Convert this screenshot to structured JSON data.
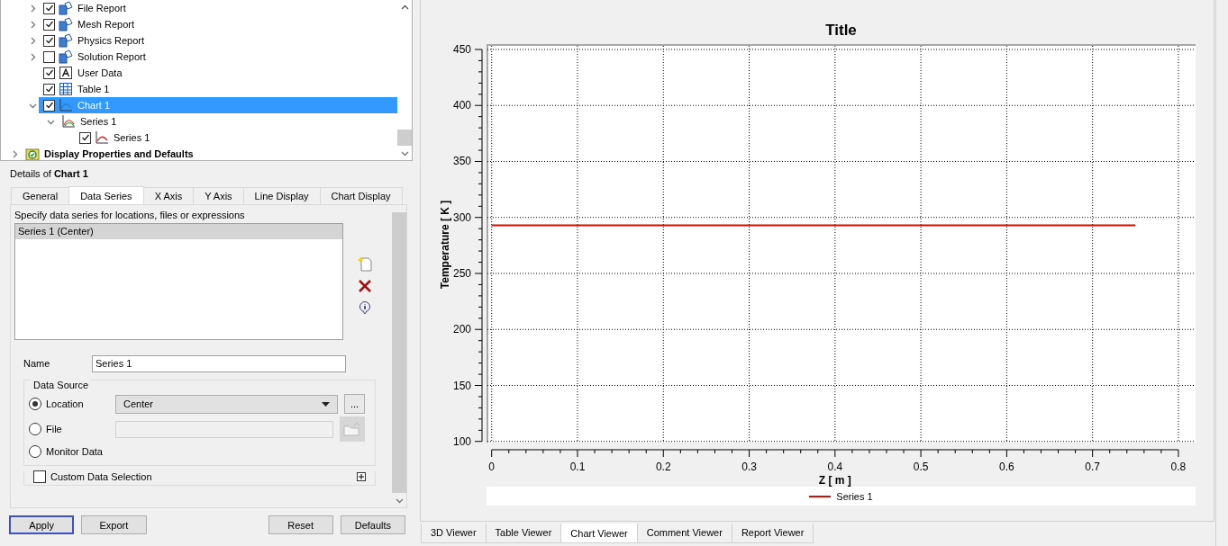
{
  "tree": [
    {
      "children": [
        {
          "label": "File Report",
          "kind": "report",
          "checked": true,
          "expanded": false,
          "selected": false
        },
        {
          "label": "Mesh Report",
          "kind": "report",
          "checked": true,
          "expanded": false,
          "selected": false
        },
        {
          "label": "Physics Report",
          "kind": "report",
          "checked": true,
          "expanded": false,
          "selected": false
        },
        {
          "label": "Solution Report",
          "kind": "report",
          "checked": false,
          "expanded": false,
          "selected": false
        },
        {
          "label": "User Data",
          "kind": "text",
          "checked": true,
          "selected": false
        },
        {
          "label": "Table 1",
          "kind": "table",
          "checked": true,
          "selected": false
        },
        {
          "label": "Chart 1",
          "kind": "chart",
          "checked": true,
          "expanded": true,
          "selected": true,
          "children": [
            {
              "label": "Series 1",
              "kind": "series",
              "expanded": true,
              "selected": false,
              "children": [
                {
                  "label": "Series 1",
                  "kind": "series-line",
                  "checked": true,
                  "selected": false
                }
              ]
            }
          ]
        }
      ]
    },
    {
      "label": "Display Properties and Defaults",
      "kind": "folder",
      "expanded": false,
      "selected": false
    }
  ],
  "details_title": "Details of **Chart 1**",
  "detail_tabs": [
    {
      "label": "General",
      "selected": false
    },
    {
      "label": "Data Series",
      "selected": true
    },
    {
      "label": "X Axis",
      "selected": false
    },
    {
      "label": "Y Axis",
      "selected": false
    },
    {
      "label": "Line Display",
      "selected": false
    },
    {
      "label": "Chart Display",
      "selected": false
    }
  ],
  "series_hint": "Specify data series for locations, files or expressions",
  "series_list": [
    {
      "label": "Series 1 (Center)",
      "selected": true
    }
  ],
  "name": {
    "label": "Name",
    "value": "Series 1"
  },
  "data_source": {
    "title": "Data Source",
    "options": [
      {
        "label": "Location",
        "selected": true,
        "kind": "dropdown",
        "value": "Center",
        "button": "..."
      },
      {
        "label": "File",
        "selected": false,
        "kind": "file",
        "disabled": true
      },
      {
        "label": "Monitor Data",
        "selected": false,
        "kind": "plain"
      }
    ]
  },
  "custom_selection": {
    "label": "Custom Data Selection",
    "checked": false,
    "expanded": false
  },
  "buttons": [
    {
      "label": "Apply",
      "focused": true
    },
    {
      "label": "Export",
      "focused": false
    },
    {
      "label": "Reset",
      "focused": false
    },
    {
      "label": "Defaults",
      "focused": false
    }
  ],
  "chart": {
    "chart_data": {
      "type": "line",
      "title": "Title",
      "xlabel": "Z [ m ]",
      "ylabel": "Temperature [ K ]",
      "x": [
        0,
        0.75
      ],
      "series": [
        {
          "name": "Series 1",
          "color": "#cc1100",
          "values": [
            293,
            293
          ]
        }
      ],
      "xlim": [
        -0.006,
        0.82
      ],
      "ylim": [
        99,
        454
      ],
      "xticks": [
        0,
        {
          "value": 0.1,
          "label": "0.1"
        },
        {
          "value": 0.2,
          "label": "0.2"
        },
        {
          "value": 0.3,
          "label": "0.3"
        },
        {
          "value": 0.4,
          "label": "0.4"
        },
        {
          "value": 0.5,
          "label": "0.5"
        },
        {
          "value": 0.6,
          "label": "0.6"
        },
        {
          "value": 0.7,
          "label": "0.7"
        },
        {
          "value": 0.8,
          "label": "0.8"
        }
      ],
      "yticks": [
        100,
        150,
        200,
        250,
        300,
        350,
        400,
        450
      ],
      "grid": true
    }
  },
  "viewer_tabs": [
    {
      "label": "3D Viewer",
      "selected": false
    },
    {
      "label": "Table Viewer",
      "selected": false
    },
    {
      "label": "Chart Viewer",
      "selected": true
    },
    {
      "label": "Comment Viewer",
      "selected": false
    },
    {
      "label": "Report Viewer",
      "selected": false
    }
  ]
}
